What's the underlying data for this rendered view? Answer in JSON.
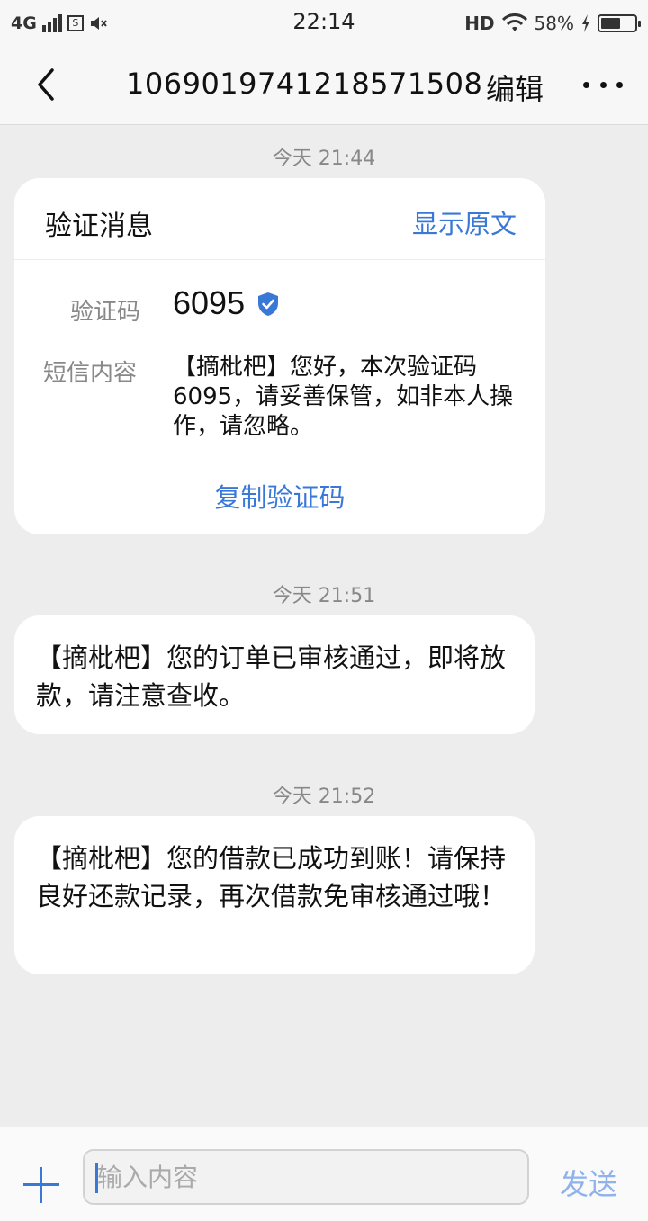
{
  "status_bar": {
    "network": "4G",
    "time": "22:14",
    "hd": "HD",
    "battery_percent": "58%",
    "battery_level": 0.58,
    "icons": [
      "signal-icon",
      "sim-icon",
      "volume-mute-icon",
      "wifi-icon",
      "charging-icon",
      "battery-icon"
    ]
  },
  "header": {
    "back_icon": "chevron-left-icon",
    "title": "1069019741218571508",
    "edit_label": "编辑",
    "more_icon": "more-horizontal-icon"
  },
  "messages": [
    {
      "timestamp": "今天 21:44",
      "card": {
        "title": "验证消息",
        "show_original": "显示原文",
        "code_label": "验证码",
        "code": "6095",
        "content_label": "短信内容",
        "content": "【摘枇杷】您好，本次验证码6095，请妥善保管，如非本人操作，请忽略。",
        "copy_label": "复制验证码"
      }
    },
    {
      "timestamp": "今天 21:51",
      "text": "【摘枇杷】您的订单已审核通过，即将放款，请注意查收。"
    },
    {
      "timestamp": "今天 21:52",
      "text": "【摘枇杷】您的借款已成功到账！请保持良好还款记录，再次借款免审核通过哦！"
    }
  ],
  "composer": {
    "placeholder": "输入内容",
    "value": "",
    "send_label": "发送",
    "add_icon": "plus-icon"
  },
  "colors": {
    "accent": "#3a78d8",
    "send_disabled": "#8fb2ec",
    "background": "#ededed",
    "bubble": "#ffffff"
  }
}
